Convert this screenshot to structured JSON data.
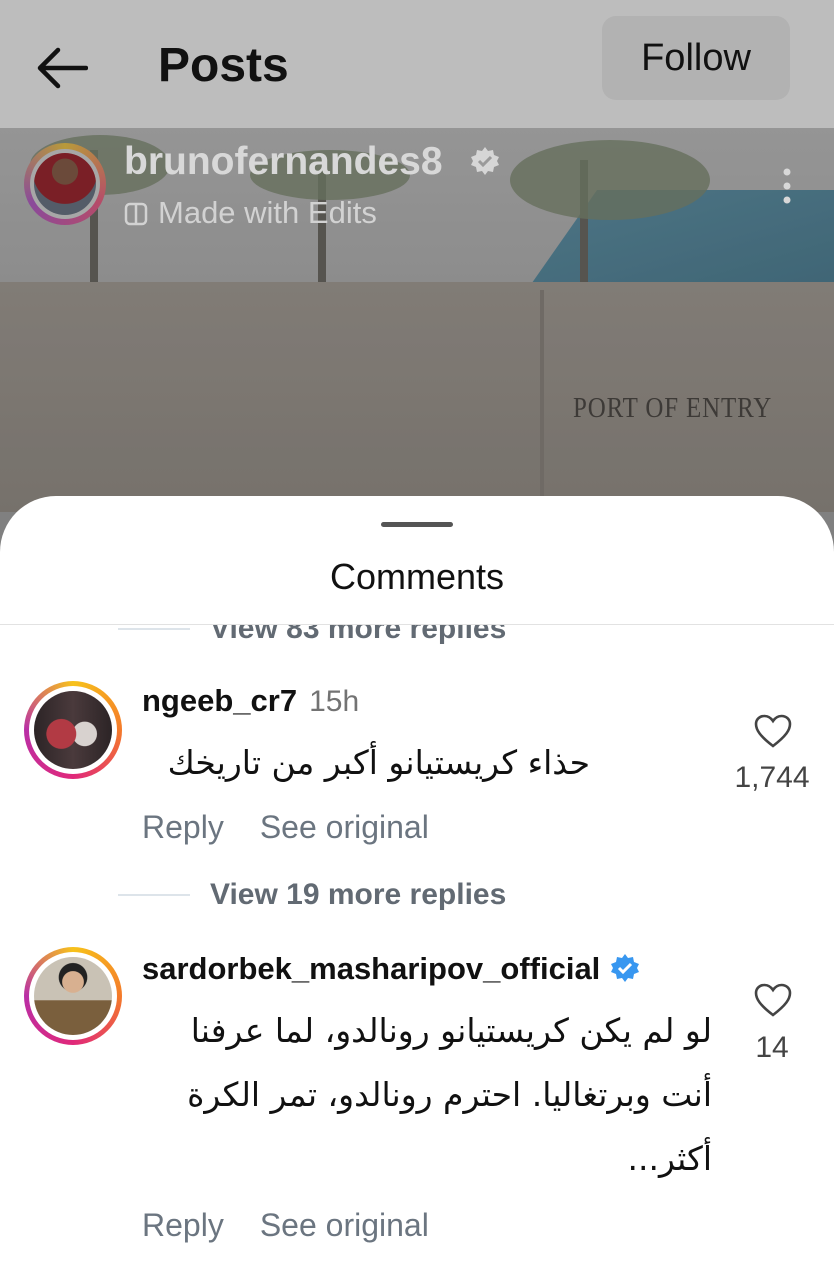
{
  "topbar": {
    "title": "Posts",
    "follow_label": "Follow"
  },
  "post": {
    "username": "brunofernandes8",
    "subtitle": "Made with Edits",
    "sign_text": "PORT OF ENTRY"
  },
  "sheet": {
    "title": "Comments"
  },
  "replies_top": "View 83 more replies",
  "comments": [
    {
      "username": "ngeeb_cr7",
      "time": "15h",
      "text": "حذاء كريستيانو أكبر من تاريخك",
      "reply_label": "Reply",
      "see_original_label": "See original",
      "likes": "1,744"
    },
    {
      "username": "sardorbek_masharipov_official",
      "verified": true,
      "text_lines": [
        "لو لم يكن كريستيانو رونالدو، لما عرفنا",
        "أنت وبرتغاليا. احترم رونالدو، تمر الكرة",
        "أكثر..."
      ],
      "reply_label": "Reply",
      "see_original_label": "See original",
      "likes": "14"
    }
  ],
  "replies_middle": "View 19 more replies",
  "colors": {
    "verified": "#3897f0",
    "ring_start": "#f7c21b",
    "ring_end": "#b92fa6"
  }
}
